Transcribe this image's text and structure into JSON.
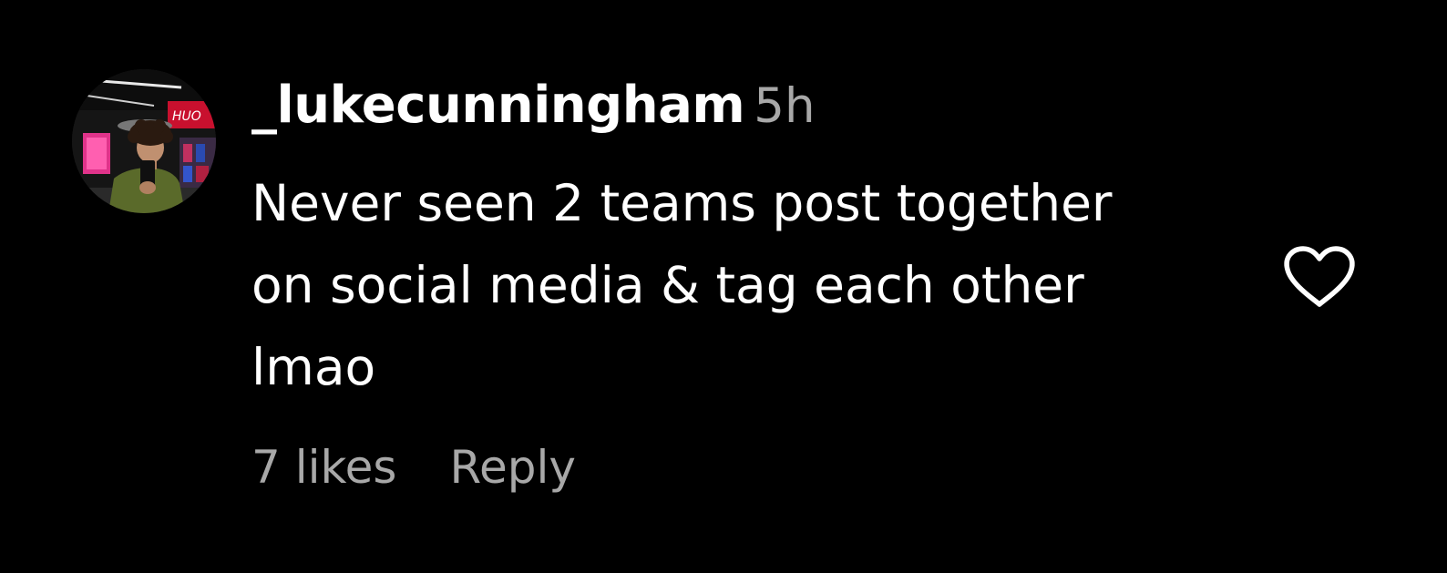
{
  "comment": {
    "username": "_lukecunningham",
    "time": "5h",
    "text": "Never seen 2 teams post together\non social media & tag each other\nlmao",
    "likes_label": "7 likes",
    "reply_label": "Reply",
    "like_icon": "heart-outline-icon",
    "avatar_sign_text": "HUO"
  },
  "colors": {
    "background": "#000000",
    "primary_text": "#ffffff",
    "secondary_text": "#a8a8a8",
    "icon": "#ffffff"
  }
}
